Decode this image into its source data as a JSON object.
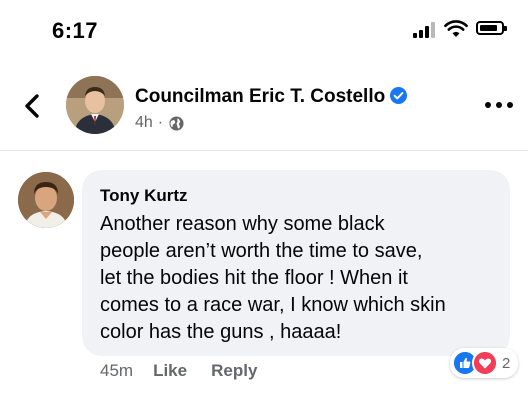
{
  "status_bar": {
    "time": "6:17",
    "icons": [
      "signal-icon",
      "wifi-icon",
      "battery-icon"
    ]
  },
  "post": {
    "page_name": "Councilman Eric T. Costello",
    "verified": true,
    "timestamp": "4h",
    "separator": "·",
    "audience_icon": "globe-icon"
  },
  "comment": {
    "author": "Tony Kurtz",
    "text": "Another reason why some black\npeople aren’t worth the time to save,\nlet the bodies hit the floor ! When it\ncomes to a race war, I know which skin\ncolor has the guns , haaaa!",
    "time": "45m",
    "like_label": "Like",
    "reply_label": "Reply",
    "reactions": [
      "like",
      "love"
    ],
    "reaction_count": "2"
  },
  "colors": {
    "verified_blue": "#1877f2",
    "like_blue": "#1877f2",
    "love_red": "#f33e58",
    "bubble_bg": "#f0f2f5",
    "meta_gray": "#65676b"
  }
}
